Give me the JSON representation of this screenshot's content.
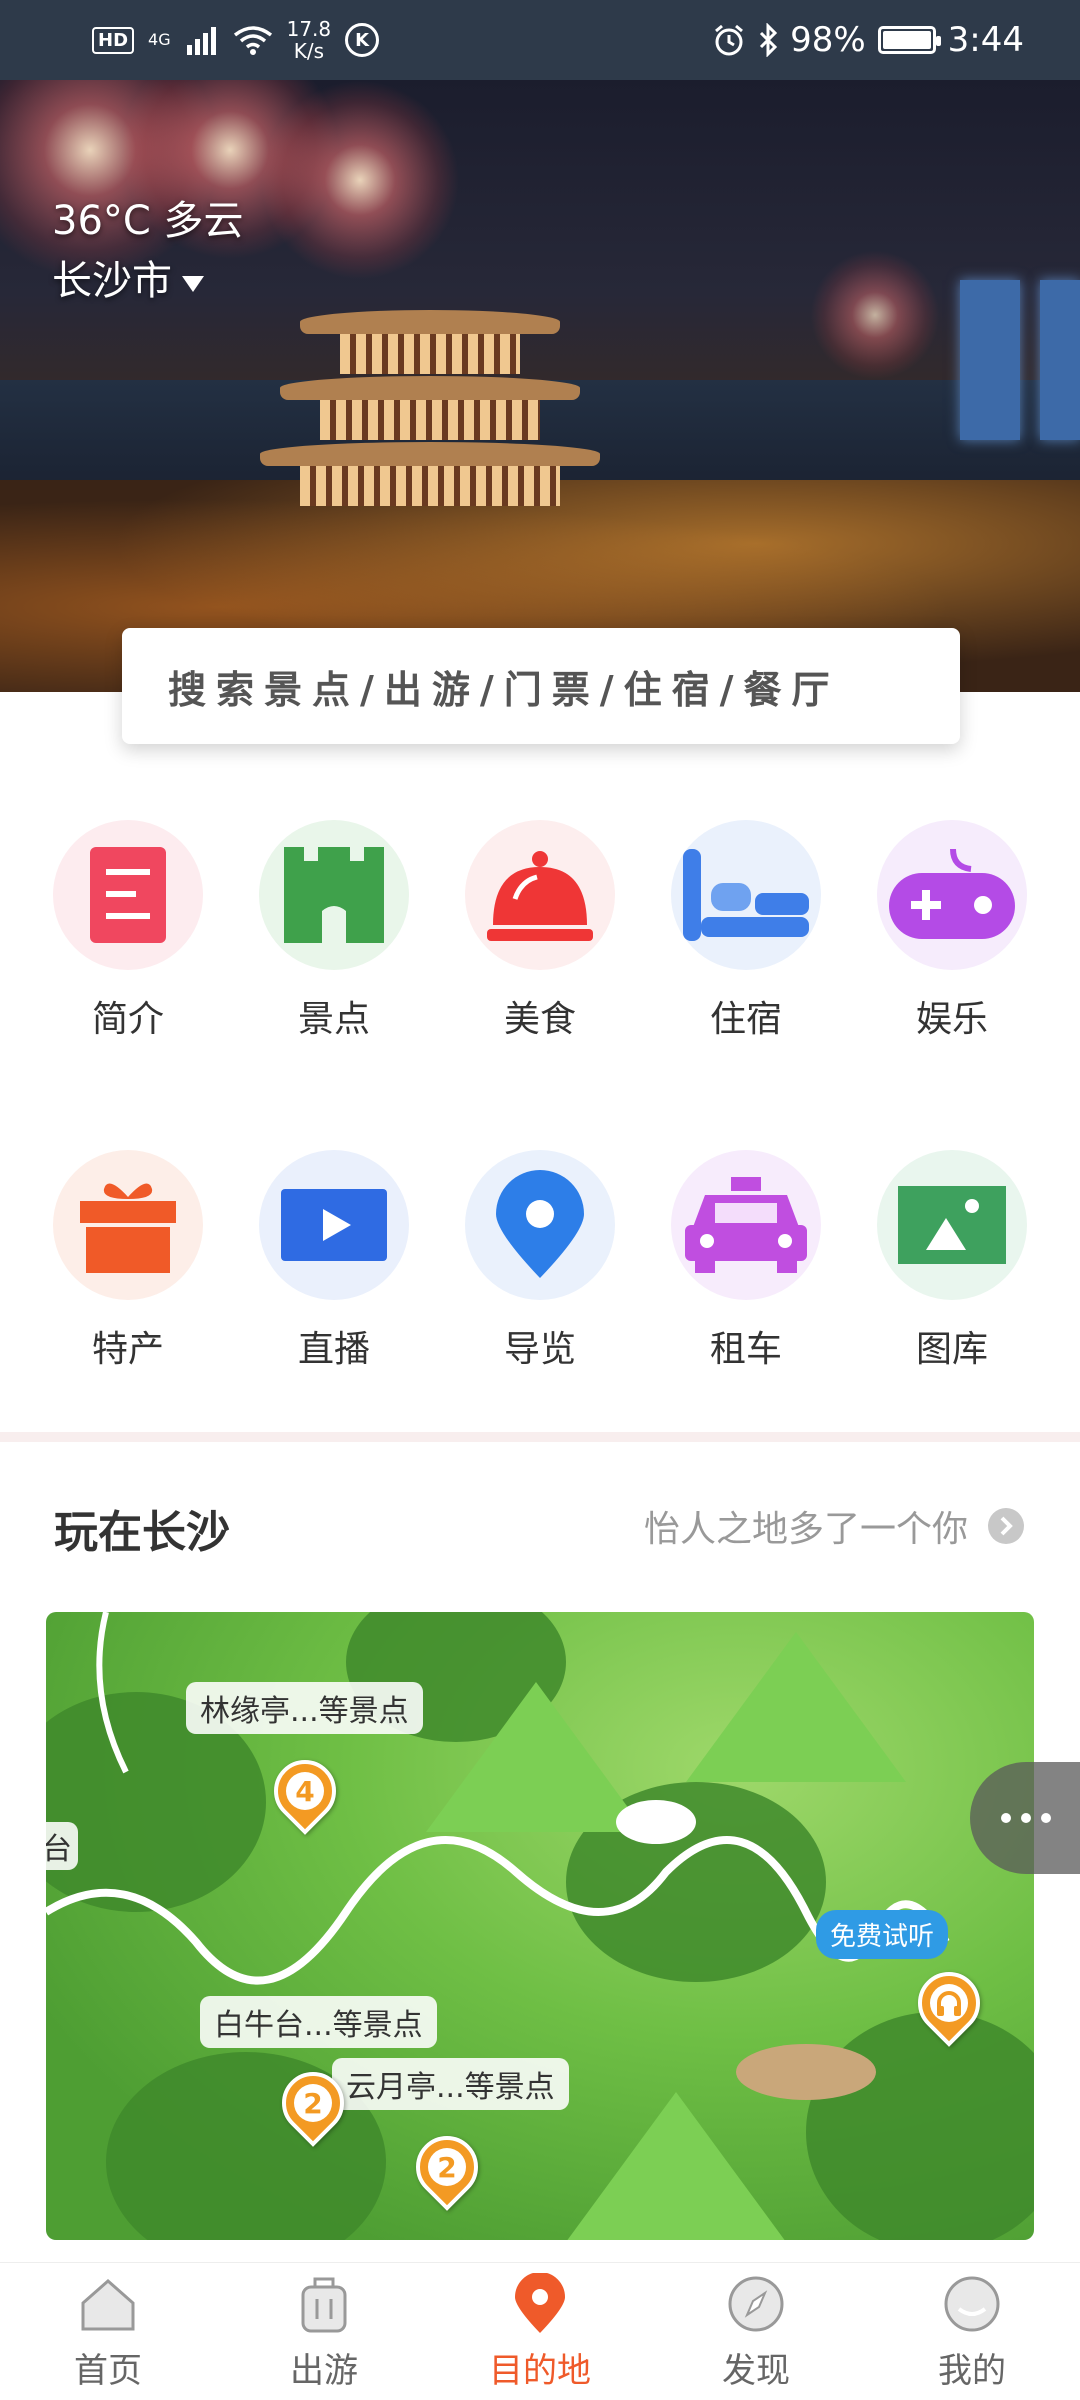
{
  "status_bar": {
    "hd": "HD",
    "net": "4G",
    "speed_value": "17.8",
    "speed_unit": "K/s",
    "k_icon_text": "K",
    "battery": "98%",
    "time": "3:44"
  },
  "hero": {
    "weather": "36°C 多云",
    "city": "长沙市"
  },
  "search": {
    "placeholder": "搜索景点/出游/门票/住宿/餐厅"
  },
  "grid": {
    "items": [
      {
        "label": "简介",
        "icon": "intro-icon",
        "color": "#f0475f"
      },
      {
        "label": "景点",
        "icon": "castle-icon",
        "color": "#3fa14b"
      },
      {
        "label": "美食",
        "icon": "cloche-icon",
        "color": "#ef3636"
      },
      {
        "label": "住宿",
        "icon": "bed-icon",
        "color": "#3f7ee8"
      },
      {
        "label": "娱乐",
        "icon": "gamepad-icon",
        "color": "#b44be6"
      },
      {
        "label": "特产",
        "icon": "gift-icon",
        "color": "#f05a28"
      },
      {
        "label": "直播",
        "icon": "play-icon",
        "color": "#2f6be3"
      },
      {
        "label": "导览",
        "icon": "location-icon",
        "color": "#2d7ee8"
      },
      {
        "label": "租车",
        "icon": "taxi-icon",
        "color": "#c04ee0"
      },
      {
        "label": "图库",
        "icon": "gallery-icon",
        "color": "#3ea15e"
      }
    ]
  },
  "section": {
    "title": "玩在长沙",
    "subtitle": "怡人之地多了一个你"
  },
  "map": {
    "labels": [
      {
        "text": "林缘亭...等景点"
      },
      {
        "text": "白牛台...等景点"
      },
      {
        "text": "云月亭...等景点"
      }
    ],
    "pins": [
      "4",
      "2",
      "2"
    ],
    "trial": "免费试听",
    "side_text": "台"
  },
  "tabbar": {
    "tabs": [
      {
        "label": "首页",
        "icon": "home-icon"
      },
      {
        "label": "出游",
        "icon": "luggage-icon"
      },
      {
        "label": "目的地",
        "icon": "destination-icon",
        "active": true
      },
      {
        "label": "发现",
        "icon": "compass-icon"
      },
      {
        "label": "我的",
        "icon": "profile-icon"
      }
    ]
  },
  "colors": {
    "accent": "#ef5a2a",
    "pin": "#f39a23"
  }
}
